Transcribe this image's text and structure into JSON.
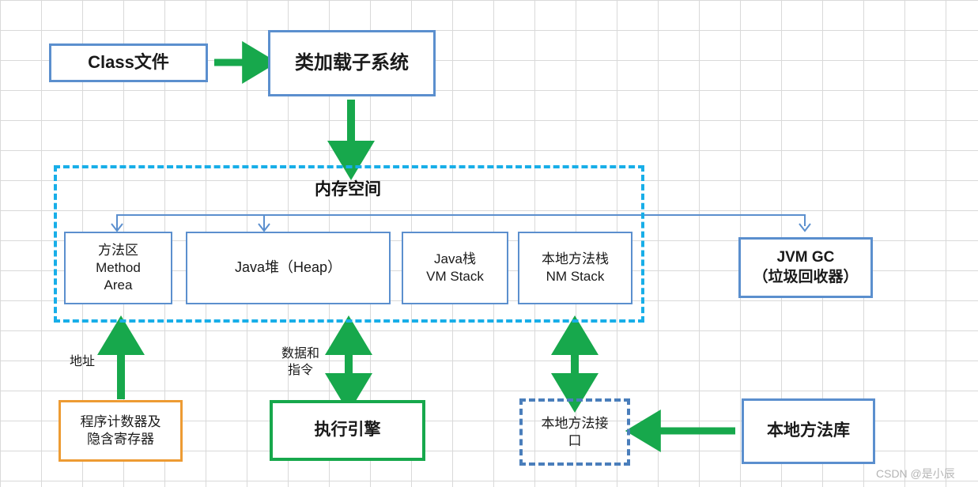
{
  "diagram": {
    "title_region": {
      "memory_space": "内存空间"
    },
    "nodes": {
      "class_file": "Class文件",
      "class_loader": "类加载子系统",
      "method_area": "方法区\nMethod\nArea",
      "java_heap": "Java堆（Heap）",
      "vm_stack": "Java栈\nVM Stack",
      "nm_stack": "本地方法栈\nNM Stack",
      "jvm_gc": "JVM GC\n（垃圾回收器）",
      "pc_register": "程序计数器及\n隐含寄存器",
      "execution_engine": "执行引擎",
      "native_interface": "本地方法接\n口",
      "native_library": "本地方法库"
    },
    "edge_labels": {
      "address": "地址",
      "data_and_instructions": "数据和\n指令"
    },
    "colors": {
      "blue_border": "#5b8fce",
      "cyan_dashed": "#18aee8",
      "blue_dashed": "#4a7ebb",
      "green_arrow": "#17a84c",
      "orange_border": "#ed9b33",
      "connector_blue": "#5b8fce",
      "grid_line": "#d9d9d9",
      "text": "#1a1a1a"
    }
  },
  "watermark": {
    "text": "CSDN @是小辰"
  }
}
